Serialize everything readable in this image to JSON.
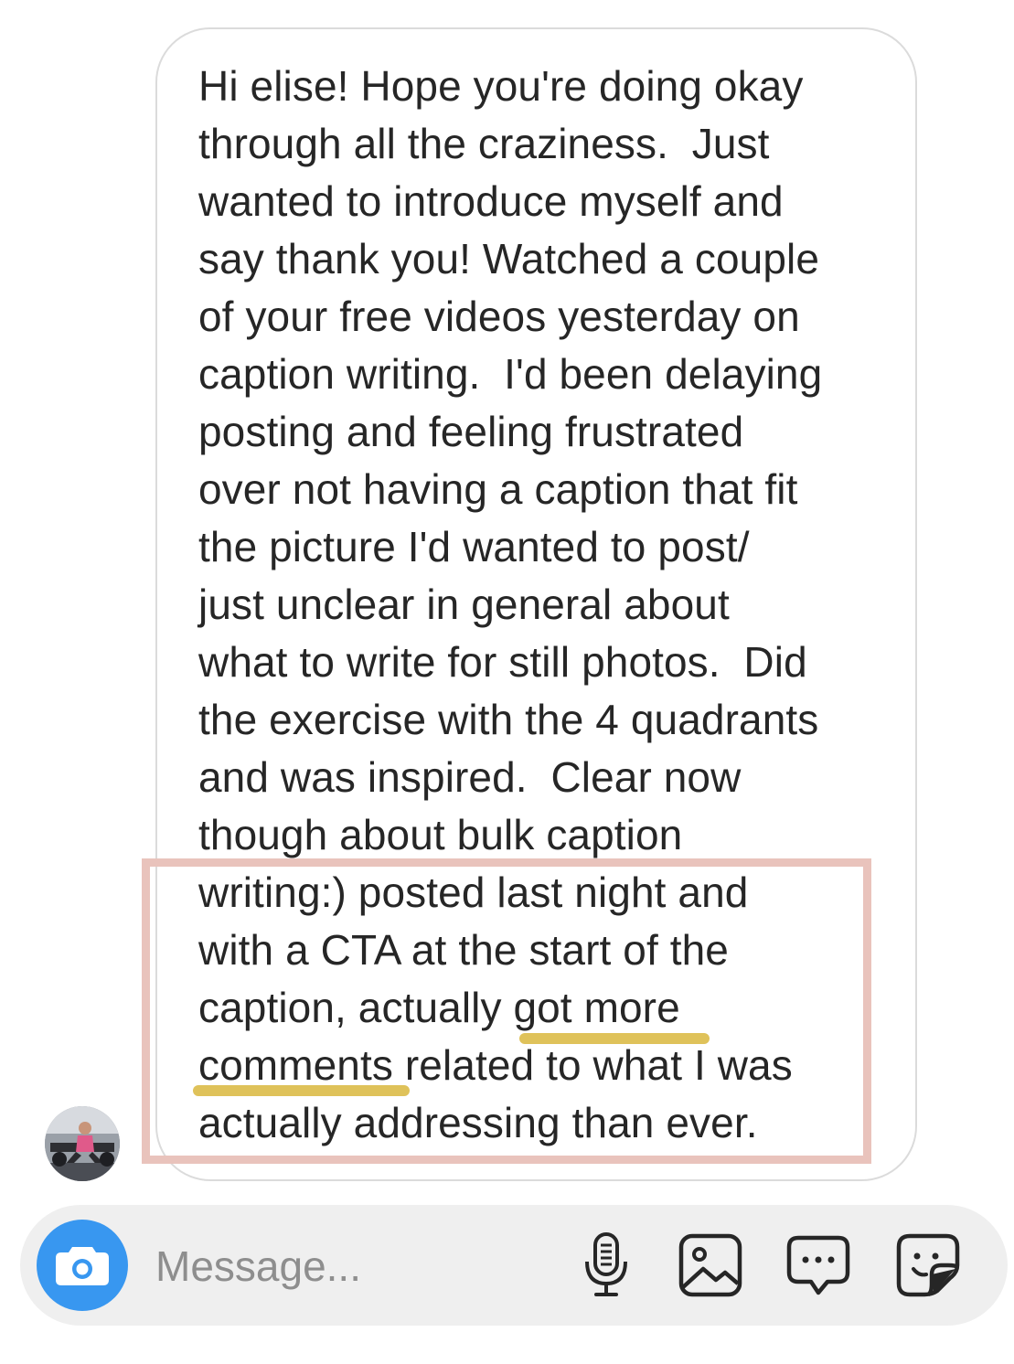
{
  "message": {
    "lines": [
      "Hi elise! Hope you're doing okay",
      "through all the craziness.  Just",
      "wanted to introduce myself and",
      "say thank you! Watched a couple",
      "of your free videos yesterday on",
      "caption writing.  I'd been delaying",
      "posting and feeling frustrated",
      "over not having a caption that fit",
      "the picture I'd wanted to post/",
      "just unclear in general about",
      "what to write for still photos.  Did",
      "the exercise with the 4 quadrants",
      "and was inspired.  Clear now",
      "though about bulk caption",
      "writing:) posted last night and",
      "with a CTA at the start of the",
      "caption, actually got more",
      "comments related to what I was",
      "actually addressing than ever."
    ]
  },
  "annotations": {
    "box_color": "#e9c3bc",
    "underline_color": "#dfc25a"
  },
  "composer": {
    "placeholder": "Message...",
    "icons": [
      "camera-icon",
      "microphone-icon",
      "gallery-icon",
      "chat-icon",
      "sticker-icon"
    ],
    "accent": "#3897f0"
  }
}
